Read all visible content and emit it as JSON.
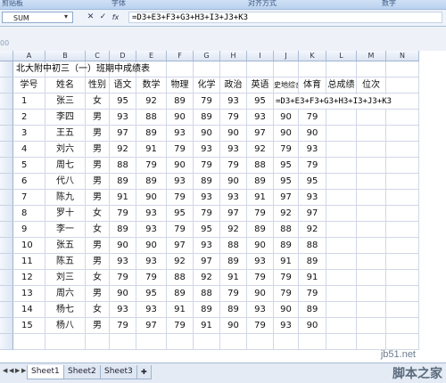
{
  "ribbon": {
    "groups": [
      "剪贴板",
      "字体",
      "对齐方式",
      "数字"
    ]
  },
  "formula_bar": {
    "name_box": "SUM",
    "cancel": "✕",
    "enter": "✓",
    "fx": "fx",
    "formula": "=D3+E3+F3+G3+H3+I3+J3+K3"
  },
  "toolbar_remnant": "00",
  "columns": [
    "A",
    "B",
    "C",
    "D",
    "E",
    "F",
    "G",
    "H",
    "I",
    "J",
    "K",
    "L",
    "M",
    "N"
  ],
  "sheet": {
    "title": "北大附中初三（一）班期中成绩表",
    "headers": [
      "学号",
      "姓名",
      "性别",
      "语文",
      "数学",
      "物理",
      "化学",
      "政治",
      "英语",
      "史地综合",
      "体育",
      "总成绩",
      "位次"
    ],
    "editing_formula": "=D3+E3+F3+G3+H3+I3+J3+K3",
    "rows": [
      [
        "1",
        "张三",
        "女",
        "95",
        "92",
        "89",
        "79",
        "93",
        "95",
        "",
        ""
      ],
      [
        "2",
        "李四",
        "男",
        "93",
        "88",
        "90",
        "89",
        "79",
        "93",
        "90",
        "79"
      ],
      [
        "3",
        "王五",
        "男",
        "97",
        "89",
        "93",
        "90",
        "90",
        "97",
        "90",
        "90"
      ],
      [
        "4",
        "刘六",
        "男",
        "92",
        "91",
        "79",
        "93",
        "93",
        "92",
        "79",
        "93"
      ],
      [
        "5",
        "周七",
        "男",
        "88",
        "79",
        "90",
        "79",
        "79",
        "88",
        "95",
        "79"
      ],
      [
        "6",
        "代八",
        "男",
        "89",
        "89",
        "93",
        "89",
        "90",
        "89",
        "95",
        "95"
      ],
      [
        "7",
        "陈九",
        "男",
        "91",
        "90",
        "79",
        "93",
        "93",
        "91",
        "97",
        "93"
      ],
      [
        "8",
        "罗十",
        "女",
        "79",
        "93",
        "95",
        "79",
        "97",
        "79",
        "92",
        "97"
      ],
      [
        "9",
        "李一",
        "女",
        "89",
        "93",
        "79",
        "95",
        "92",
        "89",
        "88",
        "92"
      ],
      [
        "10",
        "张五",
        "男",
        "90",
        "90",
        "97",
        "93",
        "88",
        "90",
        "89",
        "88"
      ],
      [
        "11",
        "陈五",
        "男",
        "93",
        "93",
        "92",
        "97",
        "89",
        "93",
        "91",
        "89"
      ],
      [
        "12",
        "刘三",
        "女",
        "79",
        "79",
        "88",
        "92",
        "91",
        "79",
        "79",
        "91"
      ],
      [
        "13",
        "周六",
        "男",
        "90",
        "95",
        "89",
        "88",
        "79",
        "90",
        "79",
        "79"
      ],
      [
        "14",
        "杨七",
        "女",
        "93",
        "93",
        "91",
        "89",
        "89",
        "93",
        "90",
        "89"
      ],
      [
        "15",
        "杨八",
        "男",
        "79",
        "97",
        "79",
        "91",
        "90",
        "79",
        "93",
        "90"
      ]
    ]
  },
  "tabs": [
    "Sheet1",
    "Sheet2",
    "Sheet3"
  ],
  "tab_nav": [
    "◀",
    "◀",
    "▶",
    "▶"
  ],
  "watermark": {
    "site": "jb51.net",
    "name": "脚本之家"
  }
}
